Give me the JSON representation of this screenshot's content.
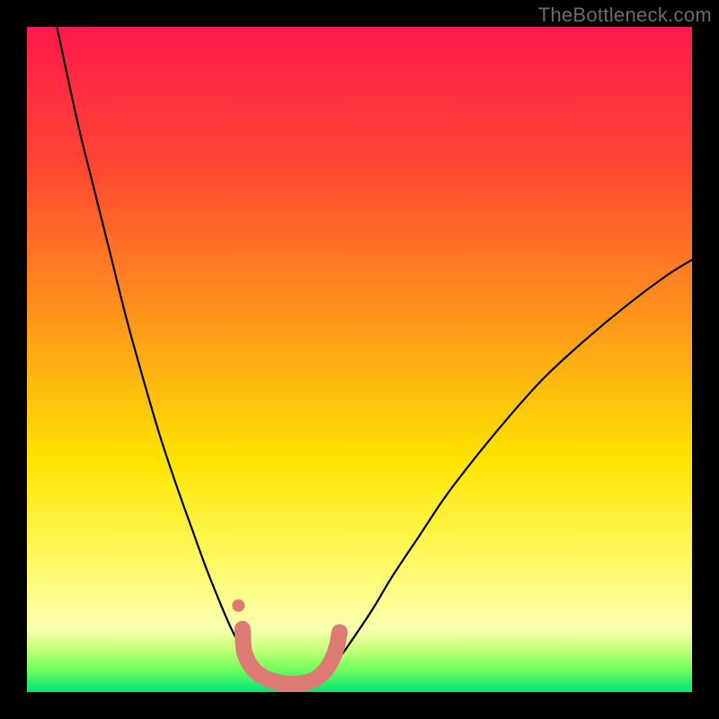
{
  "watermark": "TheBottleneck.com",
  "chart_data": {
    "type": "line",
    "title": "",
    "xlabel": "",
    "ylabel": "",
    "xlim": [
      0,
      100
    ],
    "ylim": [
      0,
      100
    ],
    "gradient_stops": [
      {
        "offset": 0.0,
        "color": "#ff1a4d"
      },
      {
        "offset": 0.2,
        "color": "#ff4433"
      },
      {
        "offset": 0.45,
        "color": "#ff9a1a"
      },
      {
        "offset": 0.65,
        "color": "#ffe400"
      },
      {
        "offset": 0.8,
        "color": "#fff960"
      },
      {
        "offset": 0.905,
        "color": "#f9ffb0"
      },
      {
        "offset": 0.935,
        "color": "#c8ff7a"
      },
      {
        "offset": 0.965,
        "color": "#73ff5c"
      },
      {
        "offset": 1.0,
        "color": "#00e676"
      }
    ],
    "series": [
      {
        "name": "curve",
        "color": "#000000",
        "stroke_width": 2.2,
        "points": [
          {
            "x": 4.5,
            "y": 100.0
          },
          {
            "x": 6.0,
            "y": 93.0
          },
          {
            "x": 8.0,
            "y": 84.0
          },
          {
            "x": 10.0,
            "y": 76.0
          },
          {
            "x": 12.5,
            "y": 66.0
          },
          {
            "x": 15.0,
            "y": 56.0
          },
          {
            "x": 17.5,
            "y": 47.0
          },
          {
            "x": 20.0,
            "y": 38.5
          },
          {
            "x": 22.5,
            "y": 31.0
          },
          {
            "x": 25.0,
            "y": 24.0
          },
          {
            "x": 27.0,
            "y": 18.5
          },
          {
            "x": 29.0,
            "y": 13.5
          },
          {
            "x": 30.5,
            "y": 10.0
          },
          {
            "x": 32.0,
            "y": 7.0
          },
          {
            "x": 33.5,
            "y": 4.5
          },
          {
            "x": 35.0,
            "y": 2.7
          },
          {
            "x": 36.5,
            "y": 1.6
          },
          {
            "x": 38.0,
            "y": 1.0
          },
          {
            "x": 40.0,
            "y": 0.8
          },
          {
            "x": 42.0,
            "y": 1.1
          },
          {
            "x": 43.5,
            "y": 1.8
          },
          {
            "x": 45.0,
            "y": 3.0
          },
          {
            "x": 47.0,
            "y": 5.2
          },
          {
            "x": 49.0,
            "y": 8.0
          },
          {
            "x": 52.0,
            "y": 12.5
          },
          {
            "x": 55.0,
            "y": 17.5
          },
          {
            "x": 59.0,
            "y": 23.5
          },
          {
            "x": 63.0,
            "y": 29.5
          },
          {
            "x": 68.0,
            "y": 36.0
          },
          {
            "x": 73.0,
            "y": 42.0
          },
          {
            "x": 78.0,
            "y": 47.5
          },
          {
            "x": 84.0,
            "y": 53.0
          },
          {
            "x": 90.0,
            "y": 58.0
          },
          {
            "x": 96.0,
            "y": 62.5
          },
          {
            "x": 100.0,
            "y": 65.0
          }
        ]
      },
      {
        "name": "highlight",
        "color": "#dd7a74",
        "stroke_width": 18,
        "linecap": "round",
        "points": [
          {
            "x": 32.4,
            "y": 9.5
          },
          {
            "x": 32.7,
            "y": 6.0
          },
          {
            "x": 33.9,
            "y": 3.6
          },
          {
            "x": 35.5,
            "y": 2.3
          },
          {
            "x": 37.5,
            "y": 1.5
          },
          {
            "x": 40.0,
            "y": 1.2
          },
          {
            "x": 42.5,
            "y": 1.6
          },
          {
            "x": 44.2,
            "y": 2.6
          },
          {
            "x": 45.5,
            "y": 4.2
          },
          {
            "x": 46.5,
            "y": 6.5
          },
          {
            "x": 47.0,
            "y": 9.0
          }
        ]
      }
    ],
    "markers": [
      {
        "name": "dot",
        "x": 31.8,
        "y": 13.0,
        "r": 7,
        "color": "#dd7a74"
      }
    ]
  }
}
